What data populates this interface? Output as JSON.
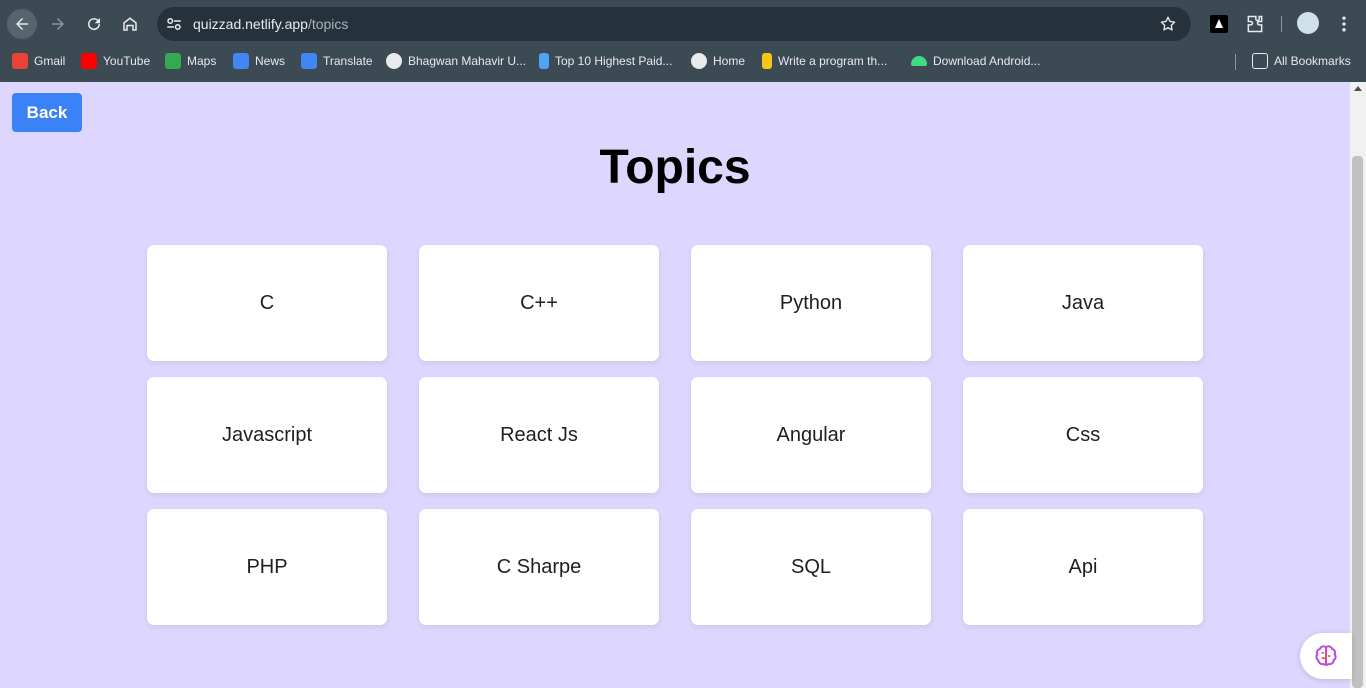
{
  "browser": {
    "url_host": "quizzad.netlify.app",
    "url_path": "/topics",
    "bookmarks": [
      {
        "label": "Gmail",
        "icon": "gmail-icon",
        "color": "#ea4335"
      },
      {
        "label": "YouTube",
        "icon": "youtube-icon",
        "color": "#ff0000"
      },
      {
        "label": "Maps",
        "icon": "maps-icon",
        "color": "#34a853"
      },
      {
        "label": "News",
        "icon": "news-icon",
        "color": "#4285f4"
      },
      {
        "label": "Translate",
        "icon": "translate-icon",
        "color": "#4285f4"
      },
      {
        "label": "Bhagwan Mahavir U...",
        "icon": "globe-icon",
        "color": "#e8eaed"
      },
      {
        "label": "Top 10 Highest Paid...",
        "icon": "bookmark-site-icon",
        "color": "#4fa3f7"
      },
      {
        "label": "Home",
        "icon": "globe-icon",
        "color": "#e8eaed"
      },
      {
        "label": "Write a program th...",
        "icon": "bookmark-site-icon",
        "color": "#f5c518"
      },
      {
        "label": "Download Android...",
        "icon": "android-icon",
        "color": "#3ddc84"
      }
    ],
    "all_bookmarks": "All Bookmarks"
  },
  "page": {
    "back_label": "Back",
    "title": "Topics",
    "topics": [
      "C",
      "C++",
      "Python",
      "Java",
      "Javascript",
      "React Js",
      "Angular",
      "Css",
      "PHP",
      "C Sharpe",
      "SQL",
      "Api"
    ]
  },
  "colors": {
    "background": "#ddd6fe",
    "back_button": "#3b82f6",
    "card": "#ffffff"
  }
}
